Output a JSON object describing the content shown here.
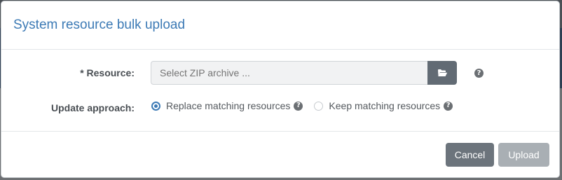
{
  "dialog": {
    "title": "System resource bulk upload"
  },
  "form": {
    "resource": {
      "label": "* Resource:",
      "placeholder": "Select ZIP archive ...",
      "value": "",
      "browse_icon": "folder-open-icon",
      "help_icon": "question-circle-icon"
    },
    "update_approach": {
      "label": "Update approach:",
      "options": [
        {
          "label": "Replace matching resources",
          "selected": true,
          "help_icon": "question-circle-icon"
        },
        {
          "label": "Keep matching resources",
          "selected": false,
          "help_icon": "question-circle-icon"
        }
      ]
    }
  },
  "footer": {
    "cancel_label": "Cancel",
    "upload_label": "Upload",
    "upload_disabled": true
  },
  "colors": {
    "accent": "#3c7ab5",
    "cancel_bg": "#6c747c",
    "upload_disabled_bg": "#a9afb4"
  }
}
